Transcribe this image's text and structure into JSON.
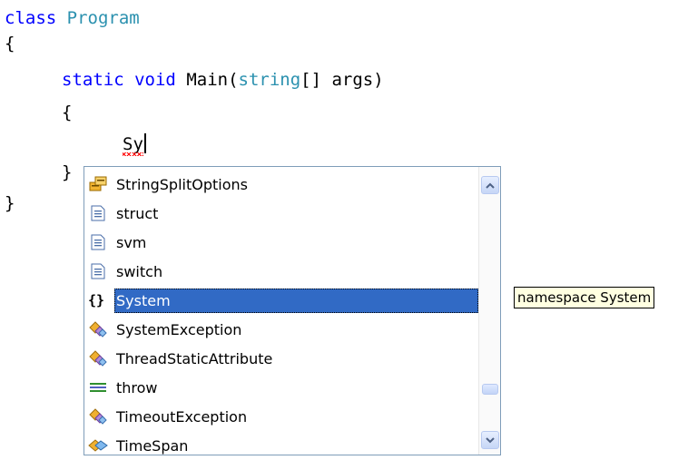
{
  "editor": {
    "line1": {
      "kw": "class",
      "type": "Program"
    },
    "line2": {
      "text": "{"
    },
    "line3": {
      "kw1": "static",
      "kw2": "void",
      "name": "Main(",
      "type": "string",
      "rest": "[] args)"
    },
    "line4": {
      "text": "{"
    },
    "line5": {
      "typed": "Sy"
    },
    "line6": {
      "text": "}"
    },
    "line7": {
      "text": "}"
    }
  },
  "completion_list": {
    "items": [
      {
        "label": "StringSplitOptions",
        "icon": "enum-icon"
      },
      {
        "label": "struct",
        "icon": "snippet-icon"
      },
      {
        "label": "svm",
        "icon": "snippet-icon"
      },
      {
        "label": "switch",
        "icon": "snippet-icon"
      },
      {
        "label": "System",
        "icon": "namespace-icon",
        "selected": true
      },
      {
        "label": "SystemException",
        "icon": "class-icon"
      },
      {
        "label": "ThreadStaticAttribute",
        "icon": "class-icon"
      },
      {
        "label": "throw",
        "icon": "keyword-icon"
      },
      {
        "label": "TimeoutException",
        "icon": "class-icon"
      },
      {
        "label": "TimeSpan",
        "icon": "struct-icon"
      }
    ],
    "scroll_position": 0.78
  },
  "tooltip": {
    "text": "namespace System"
  },
  "colors": {
    "keyword": "#0000ff",
    "type": "#2b91af",
    "selection": "#316ac5",
    "tooltip_bg": "#ffffe1"
  }
}
